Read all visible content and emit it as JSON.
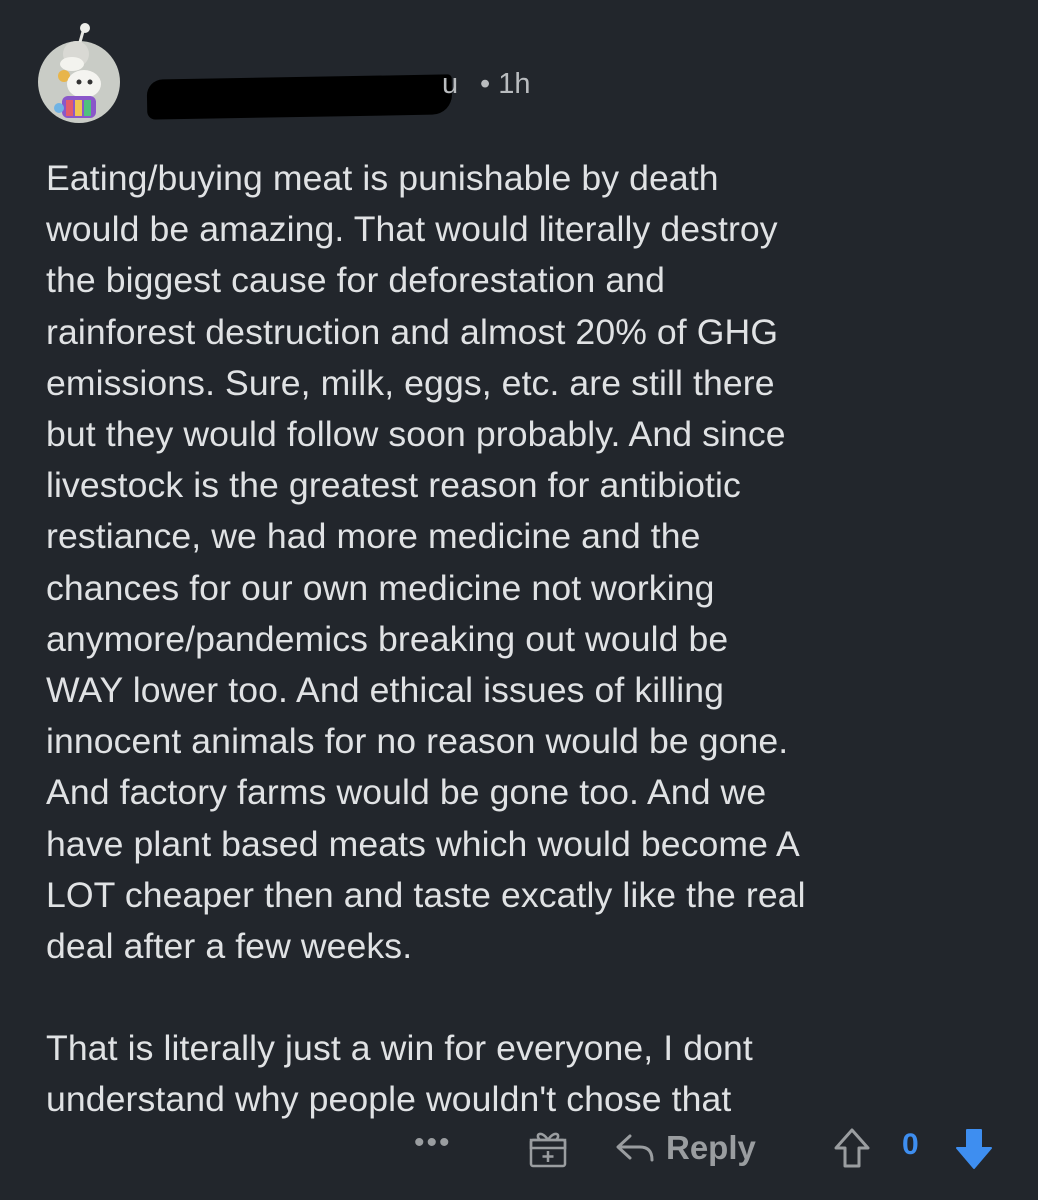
{
  "comment": {
    "username_visible_fragment": "u",
    "separator": "•",
    "age": "1h",
    "body": [
      "Eating/buying meat is punishable by death\nwould be amazing. That would literally destroy\nthe biggest cause for deforestation and\nrainforest destruction and almost 20% of GHG\nemissions. Sure, milk, eggs, etc. are still there\nbut they would follow soon probably. And since\nlivestock is the greatest reason for antibiotic\nrestiance, we had more medicine and the\nchances for our own medicine not working\nanymore/pandemics breaking out would be\nWAY lower too. And ethical issues of killing\ninnocent animals for no reason would be gone.\nAnd factory farms would be gone too. And we\nhave plant based meats which would become A\nLOT cheaper then and taste excatly like the real\ndeal after a few weeks.",
      "That is literally just a win for everyone, I dont\nunderstand why people wouldn't chose that"
    ]
  },
  "actions": {
    "more_label": "•••",
    "reply_label": "Reply",
    "score": "0"
  },
  "colors": {
    "background": "#22262c",
    "text": "#e0e2e4",
    "meta": "#b9bcbf",
    "vote_blue": "#3e8ef0"
  },
  "icons": {
    "avatar": "snoo-avatar",
    "award": "gift-icon",
    "reply": "reply-arrow-icon",
    "upvote": "upvote-arrow-icon",
    "downvote": "downvote-arrow-icon"
  }
}
